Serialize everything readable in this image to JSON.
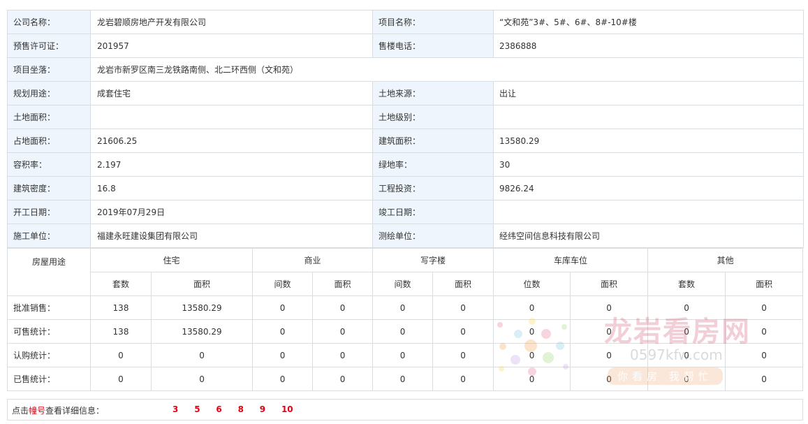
{
  "info": {
    "company_label": "公司名称：",
    "company_value": "龙岩碧顺房地产开发有限公司",
    "project_label": "项目名称：",
    "project_value": "“文和苑”3#、5#、6#、8#-10#楼",
    "permit_label": "预售许可证：",
    "permit_value": "201957",
    "phone_label": "售楼电话：",
    "phone_value": "2386888",
    "location_label": "项目坐落：",
    "location_value": "龙岩市新罗区南三龙铁路南侧、北二环西侧（文和苑）",
    "use_label": "规划用途：",
    "use_value": "成套住宅",
    "land_source_label": "土地来源：",
    "land_source_value": "出让",
    "land_area_label": "土地面积：",
    "land_area_value": "",
    "land_grade_label": "土地级别：",
    "land_grade_value": "",
    "site_area_label": "占地面积：",
    "site_area_value": "21606.25",
    "build_area_label": "建筑面积：",
    "build_area_value": "13580.29",
    "far_label": "容积率：",
    "far_value": "2.197",
    "green_label": "绿地率：",
    "green_value": "30",
    "density_label": "建筑密度：",
    "density_value": "16.8",
    "invest_label": "工程投资：",
    "invest_value": "9826.24",
    "start_label": "开工日期：",
    "start_value": "2019年07月29日",
    "finish_label": "竣工日期：",
    "finish_value": "",
    "contractor_label": "施工单位：",
    "contractor_value": "福建永旺建设集团有限公司",
    "survey_label": "测绘单位：",
    "survey_value": "经纬空间信息科技有限公司"
  },
  "stats": {
    "purpose_label": "房屋用途",
    "categories": [
      "住宅",
      "商业",
      "写字楼",
      "车库车位",
      "其他"
    ],
    "subheaders": [
      "套数",
      "面积",
      "间数",
      "面积",
      "间数",
      "面积",
      "位数",
      "面积",
      "套数",
      "面积"
    ],
    "rows": [
      {
        "label": "批准销售：",
        "values": [
          "138",
          "13580.29",
          "0",
          "0",
          "0",
          "0",
          "0",
          "0",
          "0",
          "0"
        ]
      },
      {
        "label": "可售统计：",
        "values": [
          "138",
          "13580.29",
          "0",
          "0",
          "0",
          "0",
          "0",
          "0",
          "0",
          "0"
        ]
      },
      {
        "label": "认购统计：",
        "values": [
          "0",
          "0",
          "0",
          "0",
          "0",
          "0",
          "0",
          "0",
          "0",
          "0"
        ]
      },
      {
        "label": "已售统计：",
        "values": [
          "0",
          "0",
          "0",
          "0",
          "0",
          "0",
          "0",
          "0",
          "0",
          "0"
        ]
      }
    ]
  },
  "buildings": {
    "prefix_before": "点击",
    "prefix_highlight": "幢号",
    "prefix_after": "查看详细信息：",
    "items": [
      "3",
      "5",
      "6",
      "8",
      "9",
      "10"
    ]
  },
  "watermark": {
    "brand": "龙岩看房网",
    "url": "0597kfw.com",
    "slogan": "你看房 我帮忙"
  },
  "colors": {
    "label_bg": "#eef5fc",
    "border": "#d8dde2",
    "highlight": "#e60012"
  }
}
